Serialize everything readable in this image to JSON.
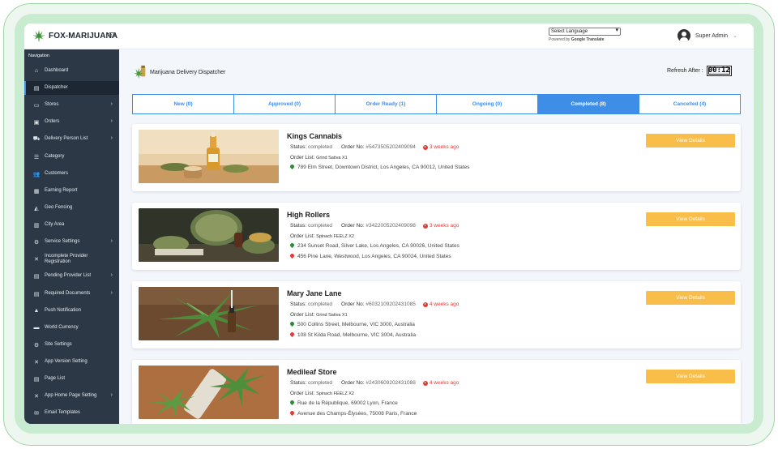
{
  "header": {
    "logo_text": "FOX-MARIJUANA",
    "language_select": "Select Language",
    "powered_by": "Powered by",
    "google_translate": "Google Translate",
    "user_name": "Super Admin"
  },
  "sidebar": {
    "title": "Navigation",
    "items": [
      {
        "label": "Dashboard",
        "icon": "home-icon"
      },
      {
        "label": "Dispatcher",
        "icon": "dispatcher-icon",
        "active": true
      },
      {
        "label": "Stores",
        "icon": "store-icon",
        "caret": true
      },
      {
        "label": "Orders",
        "icon": "orders-icon",
        "caret": true
      },
      {
        "label": "Delivery Person List",
        "icon": "delivery-icon",
        "caret": true
      },
      {
        "label": "Category",
        "icon": "list-icon"
      },
      {
        "label": "Customers",
        "icon": "customers-icon"
      },
      {
        "label": "Earning Report",
        "icon": "report-icon"
      },
      {
        "label": "Geo Fencing",
        "icon": "geo-icon"
      },
      {
        "label": "City Area",
        "icon": "city-icon"
      },
      {
        "label": "Service Settings",
        "icon": "gear-icon",
        "caret": true
      },
      {
        "label": "Incomplete Provider Registration",
        "icon": "wrench-icon"
      },
      {
        "label": "Pending Provider List",
        "icon": "pending-icon",
        "caret": true
      },
      {
        "label": "Required Documents",
        "icon": "document-icon",
        "caret": true
      },
      {
        "label": "Push Notification",
        "icon": "bell-icon"
      },
      {
        "label": "World Currency",
        "icon": "currency-icon"
      },
      {
        "label": "Site Settings",
        "icon": "settings-icon"
      },
      {
        "label": "App Version Setting",
        "icon": "tools-icon"
      },
      {
        "label": "Page List",
        "icon": "page-icon"
      },
      {
        "label": "App Home Page Setting",
        "icon": "tools-icon",
        "caret": true
      },
      {
        "label": "Email Templates",
        "icon": "email-icon"
      }
    ]
  },
  "main": {
    "title": "Marijuana Delivery Dispatcher",
    "refresh_label": "Refresh After :",
    "refresh_timer": "00:12",
    "tabs": [
      {
        "label": "New (0)"
      },
      {
        "label": "Approved (0)"
      },
      {
        "label": "Order Ready (1)"
      },
      {
        "label": "Ongoing (0)"
      },
      {
        "label": "Completed (8)",
        "active": true
      },
      {
        "label": "Cancelled (4)"
      }
    ],
    "status_label": "Status:",
    "order_no_label": "Order No:",
    "order_list_label": "Order List:",
    "details_button": "View Details",
    "orders": [
      {
        "store": "Kings Cannabis",
        "status": "completed",
        "order_no": "#5473505202409094",
        "ago": "3 weeks ago",
        "order_list": "Grind Sativa X1",
        "addresses": [
          {
            "type": "pickup",
            "text": "789 Elm Street, Downtown District, Los Angeles, CA 90012, United States"
          }
        ]
      },
      {
        "store": "High Rollers",
        "status": "completed",
        "order_no": "#3422005202409098",
        "ago": "3 weeks ago",
        "order_list": "Spinach FEELZ X2",
        "addresses": [
          {
            "type": "pickup",
            "text": "234 Sunset Road, Silver Lake, Los Angeles, CA 90026, United States"
          },
          {
            "type": "drop",
            "text": "456 Pine Lane, Westwood, Los Angeles, CA 90024, United States"
          }
        ]
      },
      {
        "store": "Mary Jane Lane",
        "status": "completed",
        "order_no": "#6032109202431085",
        "ago": "4 weeks ago",
        "order_list": "Grind Sativa X1",
        "addresses": [
          {
            "type": "pickup",
            "text": "500 Collins Street, Melbourne, VIC 3000, Australia"
          },
          {
            "type": "drop",
            "text": "108 St Kilda Road, Melbourne, VIC 3004, Australia"
          }
        ]
      },
      {
        "store": "Medileaf Store",
        "status": "completed",
        "order_no": "#2430609202431088",
        "ago": "4 weeks ago",
        "order_list": "Spinach FEELZ X2",
        "addresses": [
          {
            "type": "pickup",
            "text": "Rue de la République, 69002 Lyon, France"
          },
          {
            "type": "drop",
            "text": "Avenue des Champs-Élysées, 75008 Paris, France"
          }
        ]
      }
    ]
  },
  "colors": {
    "sidebar_bg": "#2c3846",
    "accent_blue": "#3e8ee8",
    "details_button": "#f9bd4a",
    "time_red": "#e53935",
    "pin_green": "#2e8b3a"
  }
}
